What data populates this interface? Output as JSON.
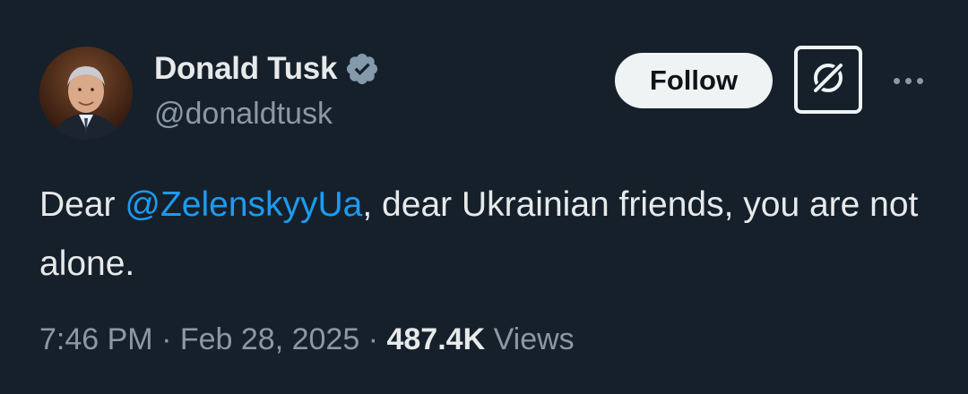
{
  "author": {
    "display_name": "Donald Tusk",
    "handle": "@donaldtusk",
    "verified": true,
    "verified_color": "#829aab"
  },
  "actions": {
    "follow_label": "Follow",
    "grok_icon": "grok-icon",
    "more_icon": "more-icon"
  },
  "tweet": {
    "text_before": "Dear ",
    "mention": "@ZelenskyyUa",
    "text_after": ", dear Ukrainian friends, you are not alone."
  },
  "meta": {
    "time": "7:46 PM",
    "date": "Feb 28, 2025",
    "separator": "·",
    "views_count": "487.4K",
    "views_label": "Views"
  },
  "colors": {
    "background": "#15202b",
    "text": "#e7e9ea",
    "secondary": "#8b98a5",
    "link": "#1d9bf0"
  }
}
